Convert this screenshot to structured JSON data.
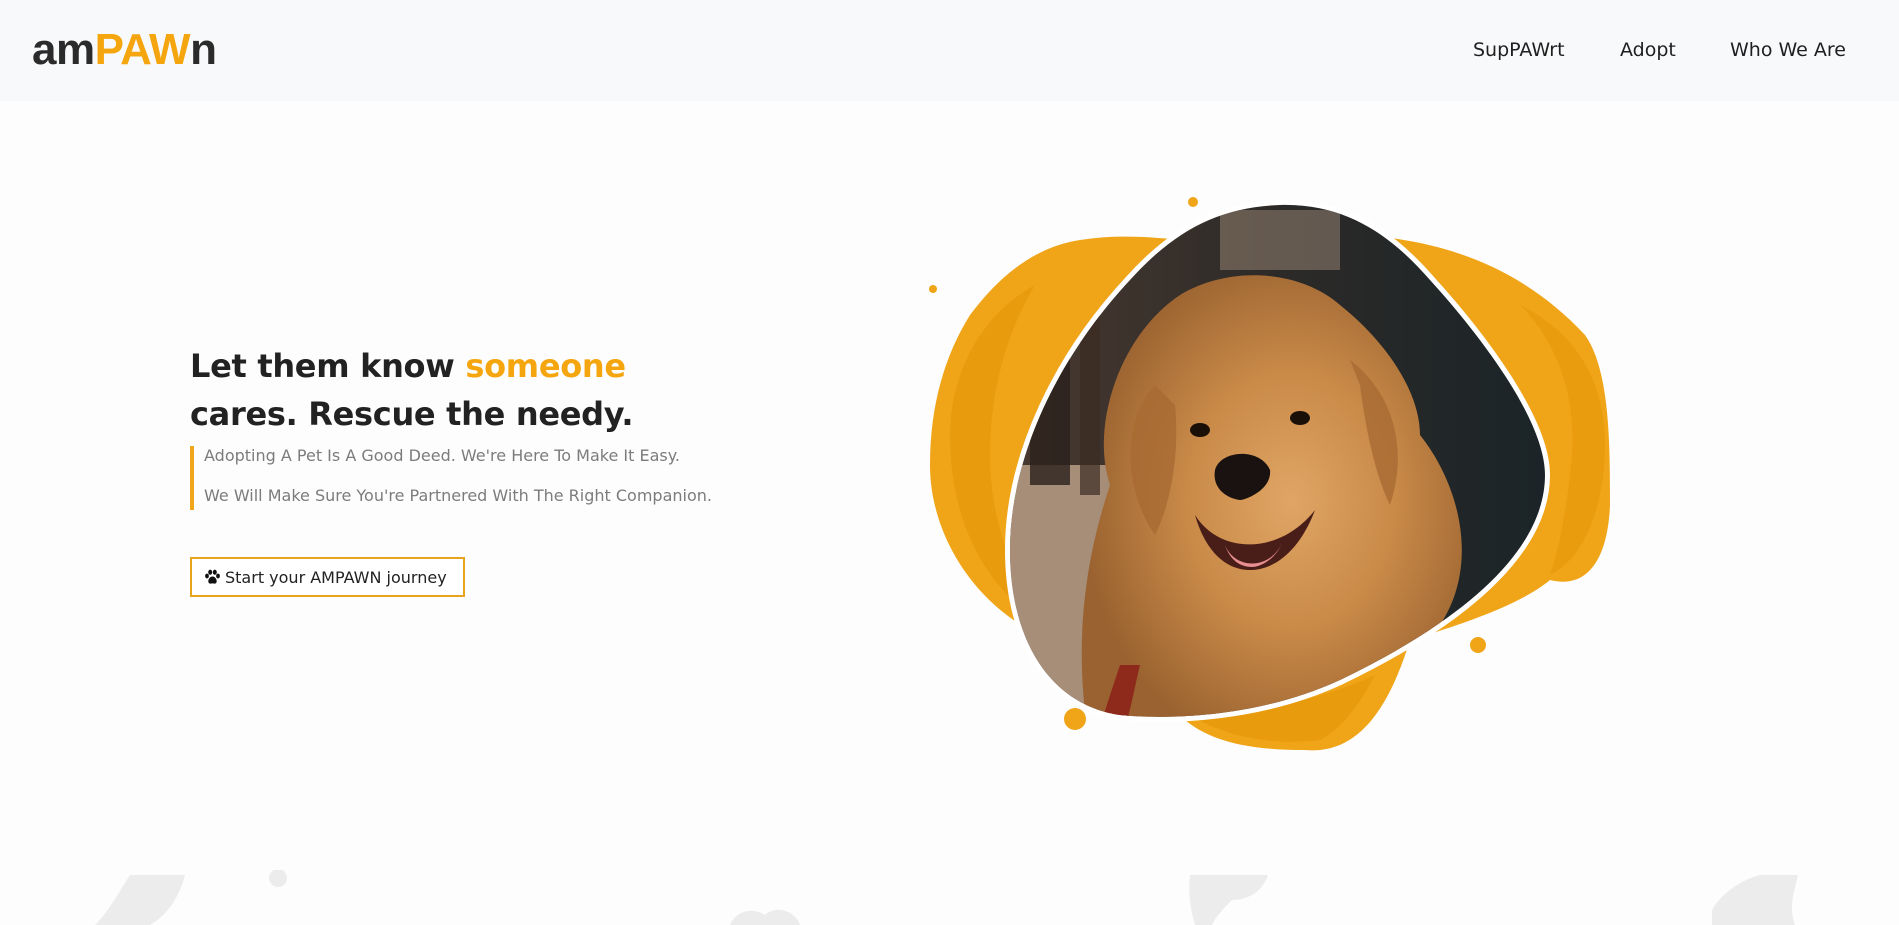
{
  "brand": {
    "logo_part1": "am",
    "logo_part2": "PAW",
    "logo_part3": "n",
    "accent_color": "#f5a60f",
    "dark_color": "#2b2b2b"
  },
  "nav": {
    "items": [
      {
        "label": "SupPAWrt"
      },
      {
        "label": "Adopt"
      },
      {
        "label": "Who We Are"
      }
    ]
  },
  "hero": {
    "headline_part1": "Let them know ",
    "headline_accent": "someone",
    "headline_part2": "cares. Rescue the needy.",
    "line1": "Adopting A Pet Is A Good Deed. We're Here To Make It Easy.",
    "line2": "We Will Make Sure You're Partnered With The Right Companion.",
    "cta_label": "Start your AMPAWN journey",
    "cta_icon": "paw-icon",
    "image": "golden-retriever-photo"
  }
}
